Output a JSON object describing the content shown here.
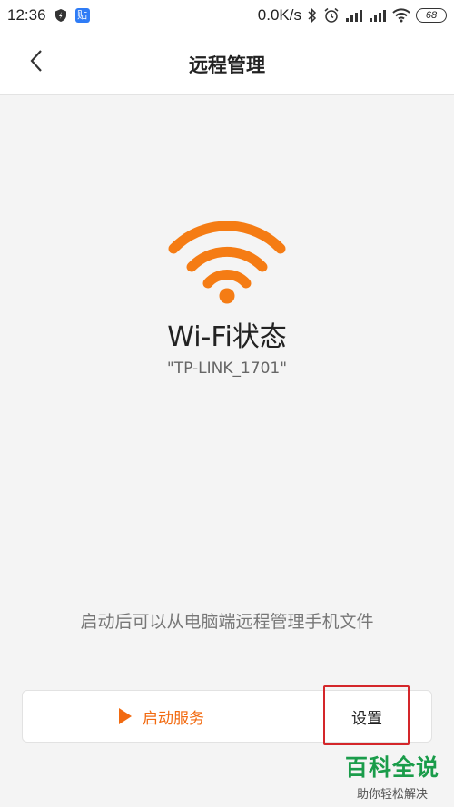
{
  "status_bar": {
    "time": "12:36",
    "network_speed": "0.0K/s",
    "battery_level": "68",
    "icons": [
      "shield-lightning-icon",
      "app-badge-icon",
      "bluetooth-icon",
      "alarm-icon",
      "signal-icon",
      "signal-icon",
      "wifi-icon",
      "battery-icon"
    ],
    "app_badge_text": "贴"
  },
  "header": {
    "title": "远程管理"
  },
  "main": {
    "wifi_status_title": "Wi-Fi状态",
    "ssid": "\"TP-LINK_1701\"",
    "description": "启动后可以从电脑端远程管理手机文件"
  },
  "actions": {
    "start_label": "启动服务",
    "settings_label": "设置"
  },
  "watermark": {
    "title": "百科全说",
    "subtitle": "助你轻松解决"
  },
  "colors": {
    "accent": "#f26a10",
    "highlight": "#d4262a",
    "watermark": "#1a9c4a"
  }
}
